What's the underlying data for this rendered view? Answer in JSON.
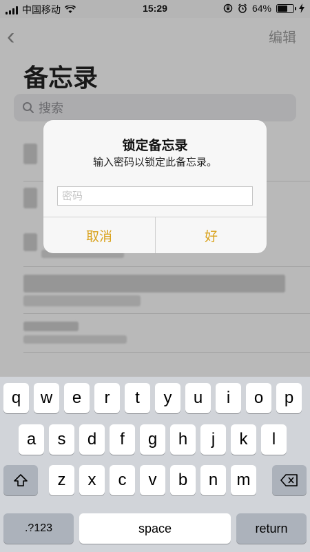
{
  "status_bar": {
    "carrier": "中国移动",
    "time": "15:29",
    "battery_percent": "64%",
    "battery_level": 0.64
  },
  "notes": {
    "edit_label": "编辑",
    "title": "备忘录",
    "search_placeholder": "搜索"
  },
  "alert": {
    "title": "锁定备忘录",
    "message": "输入密码以锁定此备忘录。",
    "password_placeholder": "密码",
    "cancel_label": "取消",
    "ok_label": "好",
    "accent_color": "#d9a21c"
  },
  "keyboard": {
    "row1": [
      "q",
      "w",
      "e",
      "r",
      "t",
      "y",
      "u",
      "i",
      "o",
      "p"
    ],
    "row2": [
      "a",
      "s",
      "d",
      "f",
      "g",
      "h",
      "j",
      "k",
      "l"
    ],
    "row3": [
      "z",
      "x",
      "c",
      "v",
      "b",
      "n",
      "m"
    ],
    "numbers_label": ".?123",
    "space_label": "space",
    "return_label": "return"
  }
}
